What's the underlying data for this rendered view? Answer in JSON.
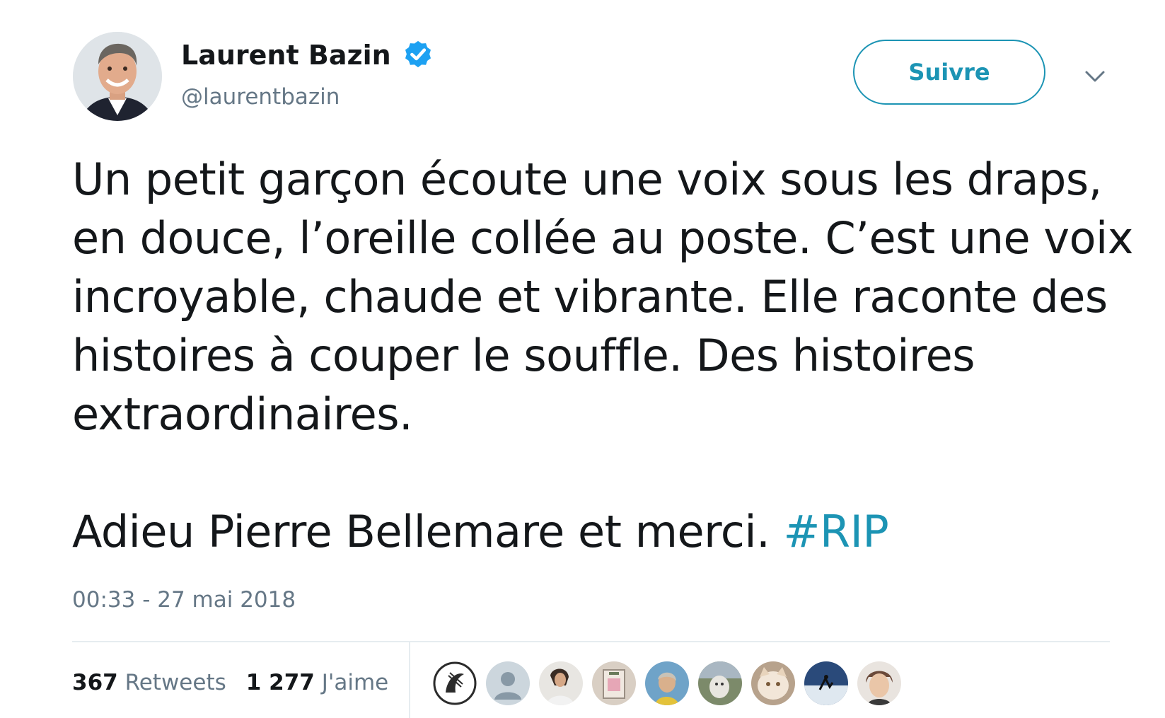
{
  "author": {
    "name": "Laurent Bazin",
    "handle": "@laurentbazin",
    "verified": true,
    "avatar_icon": "author-avatar"
  },
  "follow_button": {
    "label": "Suivre"
  },
  "menu": {
    "icon": "chevron-down-icon"
  },
  "tweet": {
    "paragraph_1": "Un petit garçon écoute une voix sous les draps, en douce, l’oreille collée au poste. C’est une voix incroyable, chaude et vibrante. Elle raconte des histoires à couper le souffle. Des histoires extraordinaires.",
    "paragraph_2": "Adieu Pierre Bellemare et merci.",
    "hashtag": "#RIP",
    "timestamp": "00:33 - 27 mai 2018"
  },
  "stats": {
    "retweets_count": "367",
    "retweets_label": "Retweets",
    "likes_count": "1 277",
    "likes_label": "J'aime"
  },
  "likers": [
    {
      "name": "liker-1",
      "color": "#2b2b2b"
    },
    {
      "name": "liker-2",
      "color": "#ccd6dd"
    },
    {
      "name": "liker-3",
      "color": "#5a4a3f"
    },
    {
      "name": "liker-4",
      "color": "#c7a9a0"
    },
    {
      "name": "liker-5",
      "color": "#6fa3c8"
    },
    {
      "name": "liker-6",
      "color": "#7c8a6a"
    },
    {
      "name": "liker-7",
      "color": "#d8b89a"
    },
    {
      "name": "liker-8",
      "color": "#2a4a7a"
    },
    {
      "name": "liker-9",
      "color": "#6b4a3a"
    }
  ],
  "colors": {
    "accent": "#1c94b4",
    "verified_badge": "#1da1f2",
    "secondary_text": "#657786",
    "primary_text": "#14171a"
  }
}
